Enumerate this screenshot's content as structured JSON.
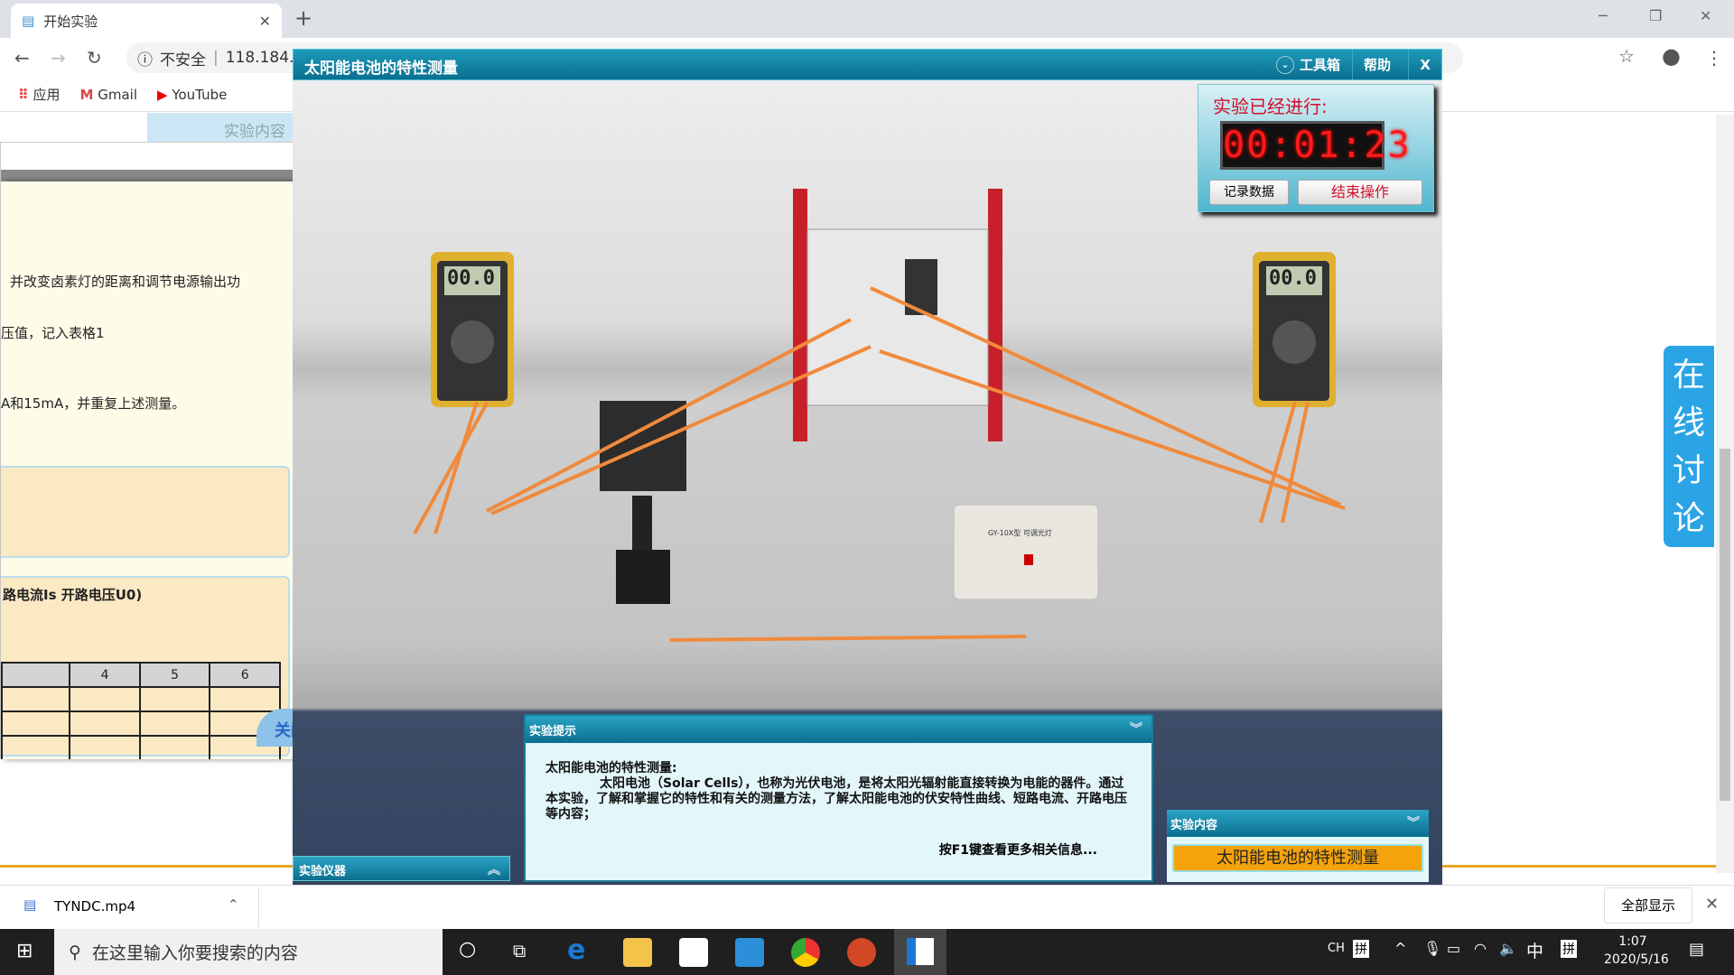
{
  "browser": {
    "tab_title": "开始实验",
    "new_tab": "+",
    "security": "不安全",
    "url": "118.184.",
    "bookmarks": [
      {
        "label": "应用",
        "icon": "apps-icon"
      },
      {
        "label": "Gmail",
        "icon": "gmail-icon"
      },
      {
        "label": "YouTube",
        "icon": "youtube-icon"
      }
    ]
  },
  "left_panel": {
    "tab_label": "实验内容",
    "close_x": "x",
    "lines": [
      "并改变卤素灯的距离和调节电源输出功",
      "压值，记入表格1",
      "A和15mA，并重复上述测量。"
    ],
    "section_title": "路电流Is  开路电压U0)",
    "table_header": [
      "",
      "4",
      "5",
      "6"
    ],
    "close_button": "关闭"
  },
  "app": {
    "title": "太阳能电池的特性测量",
    "toolbox": "工具箱",
    "help": "帮助",
    "close": "X",
    "timer": {
      "label": "实验已经进行:",
      "elapsed": "00:01:23",
      "record_button": "记录数据",
      "end_button": "结束操作"
    },
    "multimeter_reading": "00.0",
    "lamp_label": "GY-10X型 可调光灯",
    "hint": {
      "title": "实验提示",
      "heading": "太阳能电池的特性测量:",
      "body": "太阳电池（Solar   Cells），也称为光伏电池，是将太阳光辐射能直接转换为电能的器件。通过本实验，了解和掌握它的特性和有关的测量方法，了解太阳能电池的伏安特性曲线、短路电流、开路电压等内容；",
      "more": "按F1键查看更多相关信息..."
    },
    "instruments": {
      "title": "实验仪器"
    },
    "content": {
      "title": "实验内容",
      "item": "太阳能电池的特性测量"
    }
  },
  "discussion": "在线讨论",
  "download": {
    "file": "TYNDC.mp4",
    "show_all": "全部显示"
  },
  "taskbar": {
    "search_placeholder": "在这里输入你要搜索的内容",
    "ime1": "CH",
    "ime2": "拼",
    "lang": "中",
    "ime3": "拼",
    "time": "1:07",
    "date": "2020/5/16"
  },
  "colors": {
    "accent": "#0b6f90",
    "timer_red": "#ff1a1a",
    "content_orange": "#f4a30c",
    "discuss_blue": "#2ba4e6"
  }
}
